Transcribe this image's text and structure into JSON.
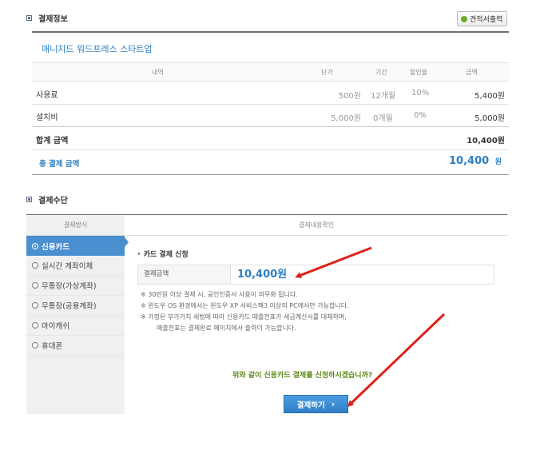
{
  "payment_info": {
    "section_title": "결제정보",
    "quote_button": "견적서출력",
    "product_name": "매니지드 워드프레스 스타트업",
    "headers": {
      "item": "내역",
      "unit_price": "단가",
      "period": "기간",
      "discount": "할인율",
      "amount": "금액"
    },
    "rows": [
      {
        "item": "사용료",
        "unit_price": "500원",
        "period": "12개월",
        "discount": "10%",
        "amount": "5,400원"
      },
      {
        "item": "설치비",
        "unit_price": "5,000원",
        "period": "0개월",
        "discount": "0%",
        "amount": "5,000원"
      }
    ],
    "subtotal_label": "합계 금액",
    "subtotal_value": "10,400원",
    "total_label": "총 결제 금액",
    "total_value": "10,400",
    "total_unit": "원"
  },
  "payment_method": {
    "section_title": "결제수단",
    "col_method": "결제방식",
    "col_confirm": "결제내용확인",
    "methods": [
      {
        "label": "신용카드",
        "active": true
      },
      {
        "label": "실시간 계좌이체",
        "active": false
      },
      {
        "label": "무통장(가상계좌)",
        "active": false
      },
      {
        "label": "무통장(공용계좌)",
        "active": false
      },
      {
        "label": "마이캐쉬",
        "active": false
      },
      {
        "label": "휴대폰",
        "active": false
      }
    ],
    "card_title": "카드 결제 신청",
    "amount_label": "결제금액",
    "amount_value": "10,400원",
    "notes": [
      "※ 30만원 이상 결제 시, 공인인증서 사용이 의무화 됩니다.",
      "※ 윈도우 OS 환경에서는 윈도우 XP 서비스팩3 이상의 PC에서만 가능합니다.",
      "※ 가정된 부가가치 세법에 따라 신용카드 매출전표가 세금계산서를 대체하며,",
      "매출전표는 결제완료 페이지에서 출력이 가능합니다."
    ],
    "confirm_question": "위와 같이 신용카드 결제를 신청하시겠습니까?",
    "pay_button": "결제하기"
  },
  "colors": {
    "accent": "#2e7fc2",
    "confirm_green": "#5a8a14",
    "arrow_red": "#e0201a",
    "active_blue": "#4a8fd0"
  }
}
